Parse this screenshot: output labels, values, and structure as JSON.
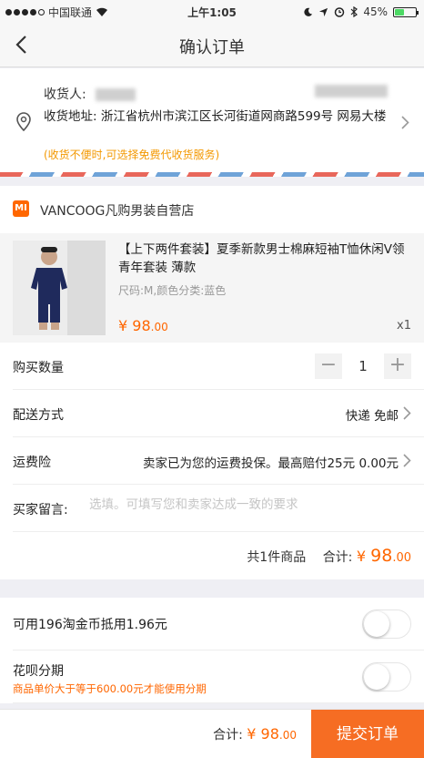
{
  "status_bar": {
    "carrier": "中国联通",
    "time": "上午1:05",
    "battery": "45%",
    "battery_level": 0.45
  },
  "nav": {
    "title": "确认订单"
  },
  "address": {
    "receiver_label": "收货人:",
    "address_label": "收货地址:",
    "address_text": "浙江省杭州市滨江区长河街道网商路599号 网易大楼",
    "tip": "(收货不便时,可选择免费代收货服务)"
  },
  "shop": {
    "logo_text": "MI",
    "name": "VANCOOG凡购男装自营店"
  },
  "product": {
    "title": "【上下两件套装】夏季新款男士棉麻短袖T恤休闲V领青年套装 薄款",
    "spec": "尺码:M,颜色分类:蓝色",
    "price_main": "¥ 98",
    "price_decimal": ".00",
    "quantity": "x1"
  },
  "order": {
    "quantity_label": "购买数量",
    "quantity_value": "1",
    "delivery_label": "配送方式",
    "delivery_value": "快递 免邮",
    "insurance_label": "运费险",
    "insurance_value": "卖家已为您的运费投保。最高赔付25元 0.00元",
    "message_label": "买家留言:",
    "message_placeholder": "选填。可填写您和卖家达成一致的要求",
    "summary_count": "共1件商品",
    "summary_total_label": "合计:",
    "summary_total_currency": "¥ ",
    "summary_total_int": "98",
    "summary_total_dec": ".00"
  },
  "extras": {
    "coins_label": "可用196淘金币抵用1.96元",
    "coins_enabled": false,
    "installment_label": "花呗分期",
    "installment_hint": "商品单价大于等于600.00元才能使用分期",
    "installment_enabled": false
  },
  "bottom": {
    "total_label": "合计:",
    "total_amount": "¥ 98",
    "total_decimal": ".00",
    "submit_label": "提交订单"
  },
  "colors": {
    "accent": "#f66d23",
    "price": "#ff6600",
    "tip": "#f39800"
  }
}
